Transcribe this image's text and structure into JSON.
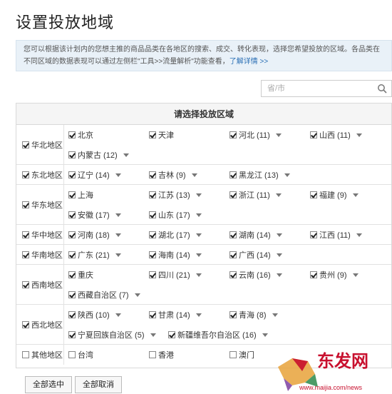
{
  "title": "设置投放地域",
  "notice": {
    "text": "您可以根据该计划内的您想主推的商品品类在各地区的搜索、成交、转化表现，选择您希望投放的区域。各品类在不同区域的数据表现可以通过左侧栏\"工具>>流量解析\"功能查看，",
    "link": "了解详情 >>"
  },
  "search": {
    "placeholder": "省/市"
  },
  "panel": {
    "header": "请选择投放区域"
  },
  "regions": [
    {
      "name": "华北地区",
      "checked": true,
      "provinces": [
        {
          "name": "北京",
          "checked": true,
          "dropdown": false
        },
        {
          "name": "天津",
          "checked": true,
          "dropdown": false
        },
        {
          "name": "河北 (11)",
          "checked": true,
          "dropdown": true
        },
        {
          "name": "山西 (11)",
          "checked": true,
          "dropdown": true
        },
        {
          "name": "内蒙古 (12)",
          "checked": true,
          "dropdown": true
        }
      ]
    },
    {
      "name": "东北地区",
      "checked": true,
      "provinces": [
        {
          "name": "辽宁 (14)",
          "checked": true,
          "dropdown": true
        },
        {
          "name": "吉林 (9)",
          "checked": true,
          "dropdown": true
        },
        {
          "name": "黑龙江 (13)",
          "checked": true,
          "dropdown": true
        }
      ]
    },
    {
      "name": "华东地区",
      "checked": true,
      "provinces": [
        {
          "name": "上海",
          "checked": true,
          "dropdown": false
        },
        {
          "name": "江苏 (13)",
          "checked": true,
          "dropdown": true
        },
        {
          "name": "浙江 (11)",
          "checked": true,
          "dropdown": true
        },
        {
          "name": "福建 (9)",
          "checked": true,
          "dropdown": true
        },
        {
          "name": "安徽 (17)",
          "checked": true,
          "dropdown": true
        },
        {
          "name": "山东 (17)",
          "checked": true,
          "dropdown": true
        }
      ]
    },
    {
      "name": "华中地区",
      "checked": true,
      "provinces": [
        {
          "name": "河南 (18)",
          "checked": true,
          "dropdown": true
        },
        {
          "name": "湖北 (17)",
          "checked": true,
          "dropdown": true
        },
        {
          "name": "湖南 (14)",
          "checked": true,
          "dropdown": true
        },
        {
          "name": "江西 (11)",
          "checked": true,
          "dropdown": true
        }
      ]
    },
    {
      "name": "华南地区",
      "checked": true,
      "provinces": [
        {
          "name": "广东 (21)",
          "checked": true,
          "dropdown": true
        },
        {
          "name": "海南 (14)",
          "checked": true,
          "dropdown": true
        },
        {
          "name": "广西 (14)",
          "checked": true,
          "dropdown": true
        }
      ]
    },
    {
      "name": "西南地区",
      "checked": true,
      "provinces": [
        {
          "name": "重庆",
          "checked": true,
          "dropdown": false
        },
        {
          "name": "四川 (21)",
          "checked": true,
          "dropdown": true
        },
        {
          "name": "云南 (16)",
          "checked": true,
          "dropdown": true
        },
        {
          "name": "贵州 (9)",
          "checked": true,
          "dropdown": true
        },
        {
          "name": "西藏自治区 (7)",
          "checked": true,
          "dropdown": true
        }
      ]
    },
    {
      "name": "西北地区",
      "checked": true,
      "provinces": [
        {
          "name": "陕西 (10)",
          "checked": true,
          "dropdown": true
        },
        {
          "name": "甘肃 (14)",
          "checked": true,
          "dropdown": true
        },
        {
          "name": "青海 (8)",
          "checked": true,
          "dropdown": true
        },
        {
          "name": "宁夏回族自治区 (5)",
          "checked": true,
          "dropdown": true
        },
        {
          "name": "新疆维吾尔自治区 (16)",
          "checked": true,
          "dropdown": true
        }
      ]
    },
    {
      "name": "其他地区",
      "checked": false,
      "provinces": [
        {
          "name": "台湾",
          "checked": false,
          "dropdown": false
        },
        {
          "name": "香港",
          "checked": false,
          "dropdown": false
        },
        {
          "name": "澳门",
          "checked": false,
          "dropdown": false
        }
      ]
    }
  ],
  "buttons": {
    "select_all": "全部选中",
    "deselect_all": "全部取消"
  },
  "watermark": {
    "text": "东发网",
    "url": "www.maijia.com/news"
  },
  "colors": {
    "notice_bg": "#e9f1f8",
    "link": "#2a6fb4",
    "watermark": "#c8102e"
  }
}
